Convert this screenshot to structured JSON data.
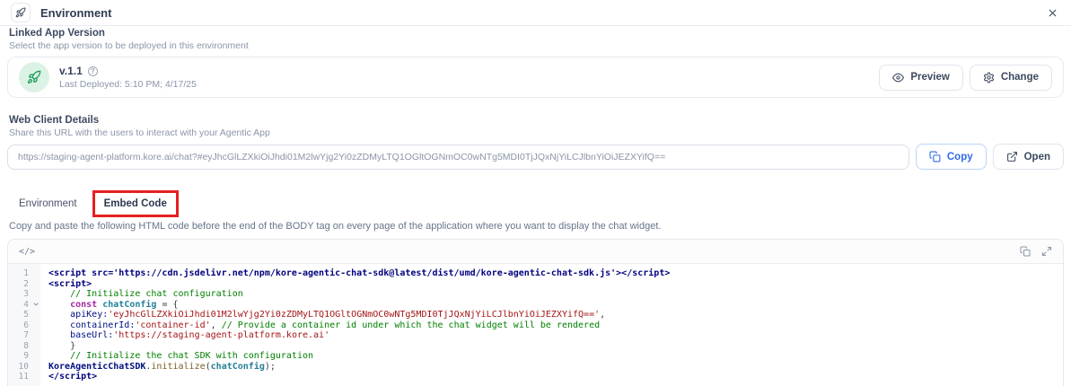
{
  "header": {
    "title": "Environment"
  },
  "icons": {
    "help": "?",
    "code_lang": "</>"
  },
  "linked_app": {
    "heading": "Linked App Version",
    "subheading": "Select the app version to be deployed in this environment",
    "version": "v.1.1",
    "last_deployed": "Last Deployed: 5:10 PM; 4/17/25",
    "preview_label": "Preview",
    "change_label": "Change"
  },
  "web_client": {
    "heading": "Web Client Details",
    "subheading": "Share this URL with the users to interact with your Agentic App",
    "url": "https://staging-agent-platform.kore.ai/chat?#eyJhcGlLZXkiOiJhdi01M2lwYjg2Yi0zZDMyLTQ1OGltOGNmOC0wNTg5MDI0TjJQxNjYiLCJlbnYiOiJEZXYifQ==",
    "copy_label": "Copy",
    "open_label": "Open"
  },
  "tabs": {
    "items": [
      {
        "label": "Environment",
        "active": false,
        "annotated": false
      },
      {
        "label": "Embed Code",
        "active": true,
        "annotated": true
      }
    ],
    "annotation_color": "#e52020"
  },
  "embed": {
    "instruction": "Copy and paste the following HTML code before the end of the BODY tag on every page of the application where you want to display the chat widget.",
    "code": {
      "lines": [
        {
          "num": 1,
          "tokens": [
            {
              "t": "<script src='https://cdn.jsdelivr.net/npm/kore-agentic-chat-sdk@latest/dist/umd/kore-agentic-chat-sdk.js'></script>",
              "c": "tag"
            }
          ]
        },
        {
          "num": 2,
          "tokens": [
            {
              "t": "<script>",
              "c": "tag"
            }
          ]
        },
        {
          "num": 3,
          "tokens": [
            {
              "t": "    // Initialize chat configuration",
              "c": "cmt"
            }
          ]
        },
        {
          "num": 4,
          "fold": true,
          "tokens": [
            {
              "t": "    ",
              "c": "def"
            },
            {
              "t": "const",
              "c": "kw"
            },
            {
              "t": " ",
              "c": "def"
            },
            {
              "t": "chatConfig",
              "c": "var"
            },
            {
              "t": " = {",
              "c": "def"
            }
          ]
        },
        {
          "num": 5,
          "tokens": [
            {
              "t": "    ",
              "c": "def"
            },
            {
              "t": "apiKey:",
              "c": "prop"
            },
            {
              "t": "'eyJhcGlLZXkiOiJhdi01M2lwYjg2Yi0zZDMyLTQ1OGltOGNmOC0wNTg5MDI0TjJQxNjYiLCJlbnYiOiJEZXYifQ=='",
              "c": "str"
            },
            {
              "t": ",",
              "c": "def"
            }
          ]
        },
        {
          "num": 6,
          "tokens": [
            {
              "t": "    ",
              "c": "def"
            },
            {
              "t": "containerId:",
              "c": "prop"
            },
            {
              "t": "'container-id'",
              "c": "str"
            },
            {
              "t": ", ",
              "c": "def"
            },
            {
              "t": "// Provide a container id under which the chat widget will be rendered",
              "c": "cmt"
            }
          ]
        },
        {
          "num": 7,
          "tokens": [
            {
              "t": "    ",
              "c": "def"
            },
            {
              "t": "baseUrl:",
              "c": "prop"
            },
            {
              "t": "'https://staging-agent-platform.kore.ai'",
              "c": "str"
            }
          ]
        },
        {
          "num": 8,
          "tokens": [
            {
              "t": "    }",
              "c": "def"
            }
          ]
        },
        {
          "num": 9,
          "tokens": [
            {
              "t": "    // Initialize the chat SDK with configuration",
              "c": "cmt"
            }
          ]
        },
        {
          "num": 10,
          "tokens": [
            {
              "t": "KoreAgenticChatSDK",
              "c": "obj"
            },
            {
              "t": ".",
              "c": "def"
            },
            {
              "t": "initialize",
              "c": "fn"
            },
            {
              "t": "(",
              "c": "def"
            },
            {
              "t": "chatConfig",
              "c": "var"
            },
            {
              "t": ");",
              "c": "def"
            }
          ]
        },
        {
          "num": 11,
          "tokens": [
            {
              "t": "</script>",
              "c": "tag"
            }
          ]
        }
      ]
    }
  }
}
